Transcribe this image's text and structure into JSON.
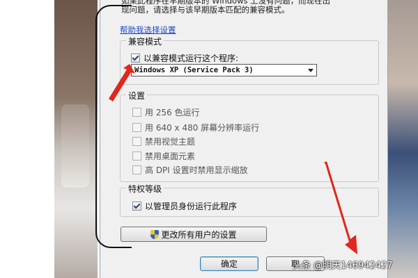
{
  "dialog": {
    "intro_line1": "如果此程序在早期版本的 Windows 上没有问题，而现在出",
    "intro_line2": "现问题，请选择与该早期版本匹配的兼容模式。",
    "help_link": "帮助我选择设置"
  },
  "compat_group": {
    "title": "兼容模式",
    "run_in_compat_label": "以兼容模式运行这个程序:",
    "run_in_compat_checked": true,
    "os_select_value": "Windows XP (Service Pack 3)"
  },
  "settings_group": {
    "title": "设置",
    "items": [
      {
        "label": "用 256 色运行",
        "checked": false
      },
      {
        "label": "用 640 x 480 屏幕分辨率运行",
        "checked": false
      },
      {
        "label": "禁用视觉主题",
        "checked": false
      },
      {
        "label": "禁用桌面元素",
        "checked": false
      },
      {
        "label": "高 DPI 设置时禁用显示缩放",
        "checked": false
      }
    ]
  },
  "privilege_group": {
    "title": "特权等级",
    "run_as_admin_label": "以管理员身份运行此程序",
    "run_as_admin_checked": true
  },
  "buttons": {
    "change_all_users": "更改所有用户的设置",
    "ok": "确定",
    "cancel": "取"
  },
  "watermark": "头条 @明天146942427",
  "colors": {
    "annotation_red": "#e0271c",
    "link_blue": "#1d46c4"
  }
}
